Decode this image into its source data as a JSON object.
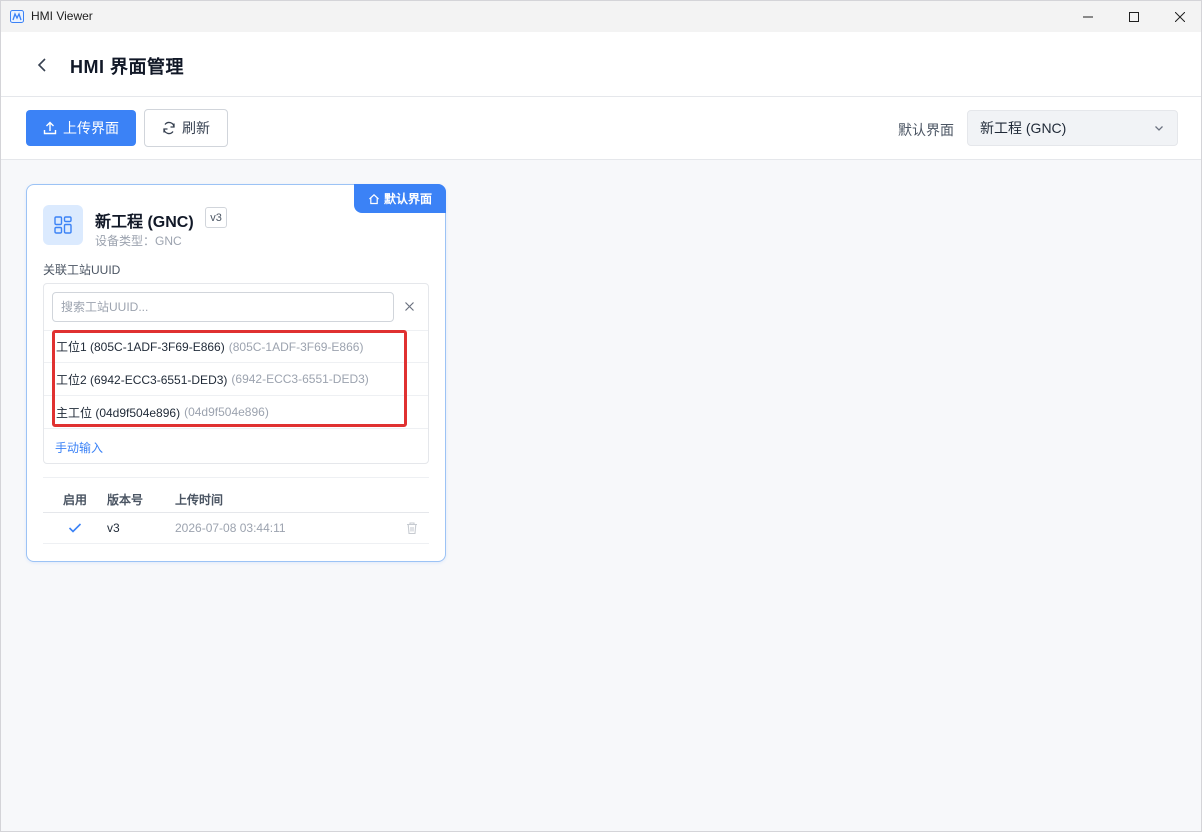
{
  "window": {
    "app_title": "HMI Viewer"
  },
  "header": {
    "title": "HMI 界面管理"
  },
  "toolbar": {
    "upload_label": "上传界面",
    "refresh_label": "刷新",
    "default_label": "默认界面",
    "default_value": "新工程 (GNC)"
  },
  "card": {
    "badge": "默认界面",
    "title": "新工程 (GNC)",
    "version": "v3",
    "device_type": "设备类型：GNC",
    "uuid_label": "关联工站UUID",
    "search_placeholder": "搜索工站UUID...",
    "uuid_options": [
      {
        "label": "工位1 (805C-1ADF-3F69-E866)",
        "sub": "(805C-1ADF-3F69-E866)"
      },
      {
        "label": "工位2 (6942-ECC3-6551-DED3)",
        "sub": "(6942-ECC3-6551-DED3)"
      },
      {
        "label": "主工位 (04d9f504e896)",
        "sub": "(04d9f504e896)"
      }
    ],
    "manual_input": "手动输入",
    "table": {
      "headers": [
        "启用",
        "版本号",
        "上传时间"
      ],
      "rows": [
        {
          "enabled": true,
          "version": "v3",
          "uploaded": "2026-07-08 03:44:11"
        }
      ]
    }
  },
  "colors": {
    "accent": "#3b82f6",
    "highlight": "#e03131"
  }
}
